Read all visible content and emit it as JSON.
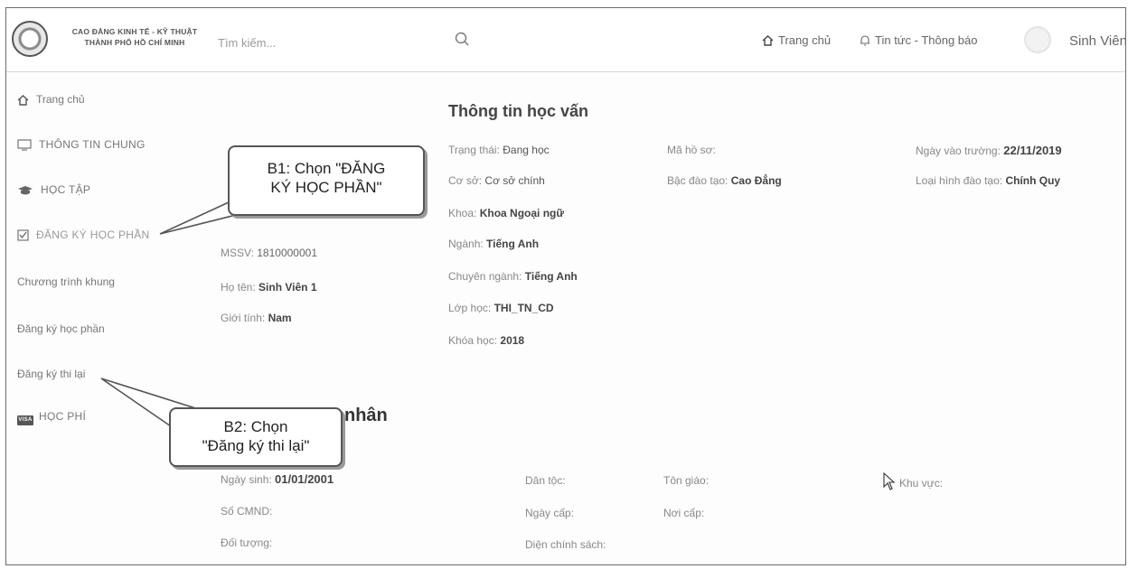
{
  "header": {
    "logo_line1": "CAO ĐẲNG KINH TẾ - KỸ THUẬT",
    "logo_line2": "THÀNH PHỐ HỒ CHÍ MINH",
    "search_placeholder": "Tìm kiếm...",
    "nav_home": "Trang chủ",
    "nav_news": "Tin tức - Thông báo",
    "user_name": "Sinh Viên 1"
  },
  "sidebar": {
    "home": "Trang chủ",
    "general_info": "THÔNG TIN CHUNG",
    "study": "HỌC TẬP",
    "course_registration": "ĐĂNG KÝ HỌC PHẦN",
    "curriculum": "Chương trình khung",
    "register_course": "Đăng ký học phần",
    "register_retake": "Đăng ký thi lại",
    "tuition": "HỌC PHÍ",
    "visa_icon_text": "VISA"
  },
  "student": {
    "mssv_label": "MSSV:",
    "mssv": "1810000001",
    "name_label": "Họ tên:",
    "name": "Sinh Viên 1",
    "gender_label": "Giới tính:",
    "gender": "Nam"
  },
  "education": {
    "title": "Thông tin học vấn",
    "status_label": "Trạng thái:",
    "status": "Đang học",
    "campus_label": "Cơ sở:",
    "campus": "Cơ sở chính",
    "faculty_label": "Khoa:",
    "faculty": "Khoa Ngoại ngữ",
    "major_label": "Ngành:",
    "major": "Tiếng Anh",
    "specialization_label": "Chuyên ngành:",
    "specialization": "Tiếng Anh",
    "class_label": "Lớp học:",
    "class": "THI_TN_CD",
    "cohort_label": "Khóa học:",
    "cohort": "2018",
    "record_label": "Mã hồ sơ:",
    "level_label": "Bậc đào tạo:",
    "level": "Cao Đẳng",
    "enroll_date_label": "Ngày vào trường:",
    "enroll_date": "22/11/2019",
    "training_type_label": "Loại hình đào tạo:",
    "training_type": "Chính Quy"
  },
  "personal": {
    "title_visible": "nhân",
    "dob_label": "Ngày sinh:",
    "dob": "01/01/2001",
    "ethnicity_label": "Dân tộc:",
    "religion_label": "Tôn giáo:",
    "region_label": "Khu vực:",
    "id_label": "Số CMND:",
    "issue_date_label": "Ngày cấp:",
    "issue_place_label": "Nơi cấp:",
    "subject_label": "Đối tượng:",
    "policy_label": "Diện chính sách:"
  },
  "callouts": {
    "b1_line1": "B1: Chọn \"ĐĂNG",
    "b1_line2": "KÝ HỌC PHẦN\"",
    "b2_line1": "B2: Chọn",
    "b2_line2": "\"Đăng ký thi lại\""
  }
}
